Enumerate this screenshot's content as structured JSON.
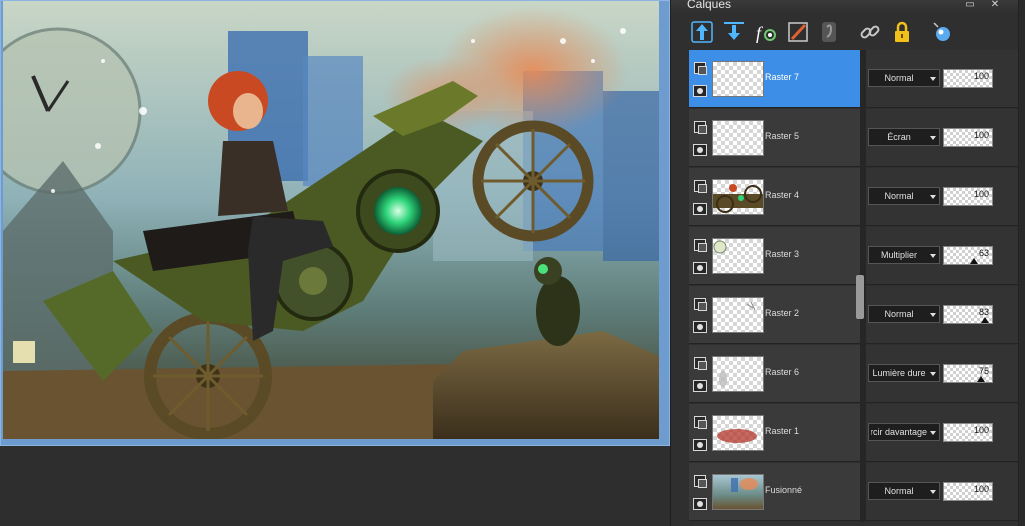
{
  "panel": {
    "title": "Calques",
    "minimize_glyph": "▭",
    "close_glyph": "✕"
  },
  "toolbar": {
    "tools": [
      {
        "name": "move-layer-up-icon",
        "color": "#4fb7ff"
      },
      {
        "name": "move-layer-down-icon",
        "color": "#4fb7ff"
      },
      {
        "name": "layer-effects-icon",
        "color": "#ffffff"
      },
      {
        "name": "paint-brush-icon",
        "color": "#e06030"
      },
      {
        "name": "layer-style-icon",
        "color": "#888888"
      },
      {
        "name": "link-icon",
        "color": "#c8c8c8"
      },
      {
        "name": "lock-icon",
        "color": "#f2c01a"
      },
      {
        "name": "highlight-icon",
        "color": "#5aaaf0"
      }
    ]
  },
  "layers": [
    {
      "name": "Raster 7",
      "blend": "Normal",
      "opacity": "100",
      "selected": true
    },
    {
      "name": "Raster 5",
      "blend": "Écran",
      "opacity": "100",
      "selected": false
    },
    {
      "name": "Raster 4",
      "blend": "Normal",
      "opacity": "100",
      "selected": false
    },
    {
      "name": "Raster 3",
      "blend": "Multiplier",
      "opacity": "63",
      "selected": false
    },
    {
      "name": "Raster 2",
      "blend": "Normal",
      "opacity": "83",
      "selected": false
    },
    {
      "name": "Raster 6",
      "blend": "Lumière dure",
      "opacity": "75",
      "selected": false
    },
    {
      "name": "Raster 1",
      "blend": "Éclaircir davantage",
      "opacity": "100",
      "selected": false
    },
    {
      "name": "Fusionné",
      "blend": "Normal",
      "opacity": "100",
      "selected": false
    }
  ],
  "colors": {
    "selection": "#3d8ee6",
    "panel_bg": "#2f2f2f"
  }
}
